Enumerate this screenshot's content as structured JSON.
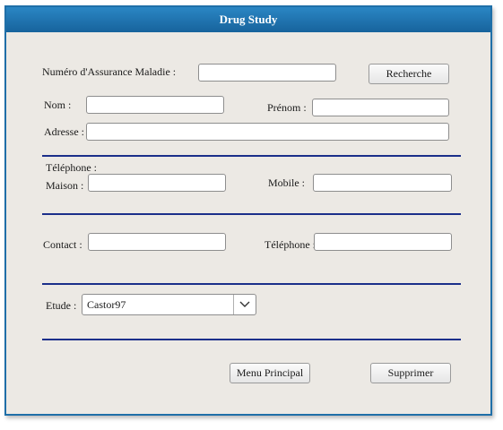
{
  "window": {
    "title": "Drug Study"
  },
  "form": {
    "nam_label": "Numéro d'Assurance Maladie :",
    "nam_value": "",
    "search_button": "Recherche",
    "nom_label": "Nom :",
    "nom_value": "",
    "prenom_label": "Prénom :",
    "prenom_value": "",
    "adresse_label": "Adresse :",
    "adresse_value": "",
    "telephone_header": "Téléphone :",
    "maison_label": "Maison  :",
    "maison_value": "",
    "mobile_label": "Mobile :",
    "mobile_value": "",
    "contact_label": "Contact :",
    "contact_value": "",
    "contact_tel_label": "Téléphone :",
    "contact_tel_value": "",
    "etude_label": "Etude :",
    "etude_selected": "Castor97",
    "etude_icon": "chevron-down-icon",
    "menu_button": "Menu Principal",
    "delete_button": "Supprimer"
  },
  "colors": {
    "title_bar": "#1f6fa8",
    "separator": "#1b2f8a",
    "panel_background": "#ece9e4"
  }
}
